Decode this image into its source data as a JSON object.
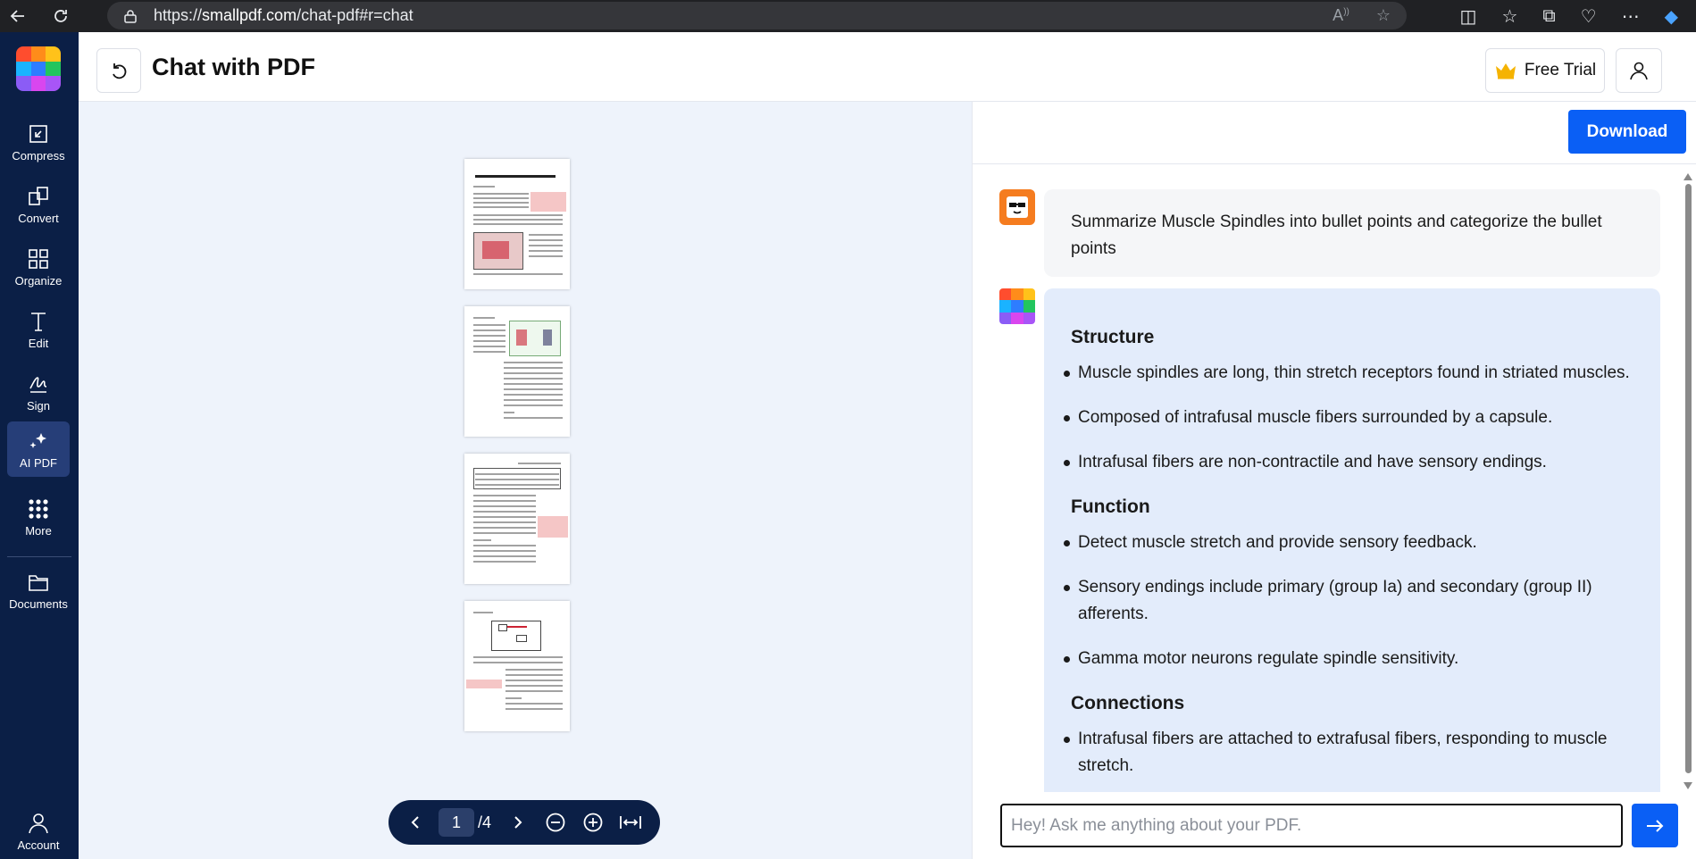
{
  "browser": {
    "url_prefix": "https://",
    "url_host": "smallpdf.com",
    "url_path": "/chat-pdf#r=chat"
  },
  "sidebar": {
    "items": [
      {
        "label": "Compress",
        "icon": "compress-icon"
      },
      {
        "label": "Convert",
        "icon": "convert-icon"
      },
      {
        "label": "Organize",
        "icon": "organize-icon"
      },
      {
        "label": "Edit",
        "icon": "edit-icon"
      },
      {
        "label": "Sign",
        "icon": "sign-icon"
      },
      {
        "label": "AI PDF",
        "icon": "sparkle-icon"
      },
      {
        "label": "More",
        "icon": "dots-grid-icon"
      },
      {
        "label": "Documents",
        "icon": "folder-icon"
      },
      {
        "label": "Account",
        "icon": "user-icon"
      }
    ],
    "active": "AI PDF"
  },
  "header": {
    "title": "Chat with PDF",
    "free_trial_label": "Free Trial"
  },
  "viewer": {
    "page_current": "1",
    "page_total": "/4",
    "page_count": 4
  },
  "chat": {
    "download_label": "Download",
    "user_message": "Summarize Muscle Spindles into bullet points and categorize the bullet points",
    "ai_sections": [
      {
        "heading": "Structure",
        "bullets": [
          "Muscle spindles are long, thin stretch receptors found in striated muscles.",
          "Composed of intrafusal muscle fibers surrounded by a capsule.",
          "Intrafusal fibers are non-contractile and have sensory endings."
        ]
      },
      {
        "heading": "Function",
        "bullets": [
          "Detect muscle stretch and provide sensory feedback.",
          "Sensory endings include primary (group Ia) and secondary (group II) afferents.",
          "Gamma motor neurons regulate spindle sensitivity."
        ]
      },
      {
        "heading": "Connections",
        "bullets": [
          "Intrafusal fibers are attached to extrafusal fibers, responding to muscle stretch."
        ]
      }
    ],
    "input_placeholder": "Hey! Ask me anything about your PDF."
  },
  "colors": {
    "sidebar_bg": "#0b1f46",
    "accent_blue": "#0a5ff5",
    "ai_bubble": "#e3ecfb",
    "viewer_bg": "#eef3fb"
  }
}
